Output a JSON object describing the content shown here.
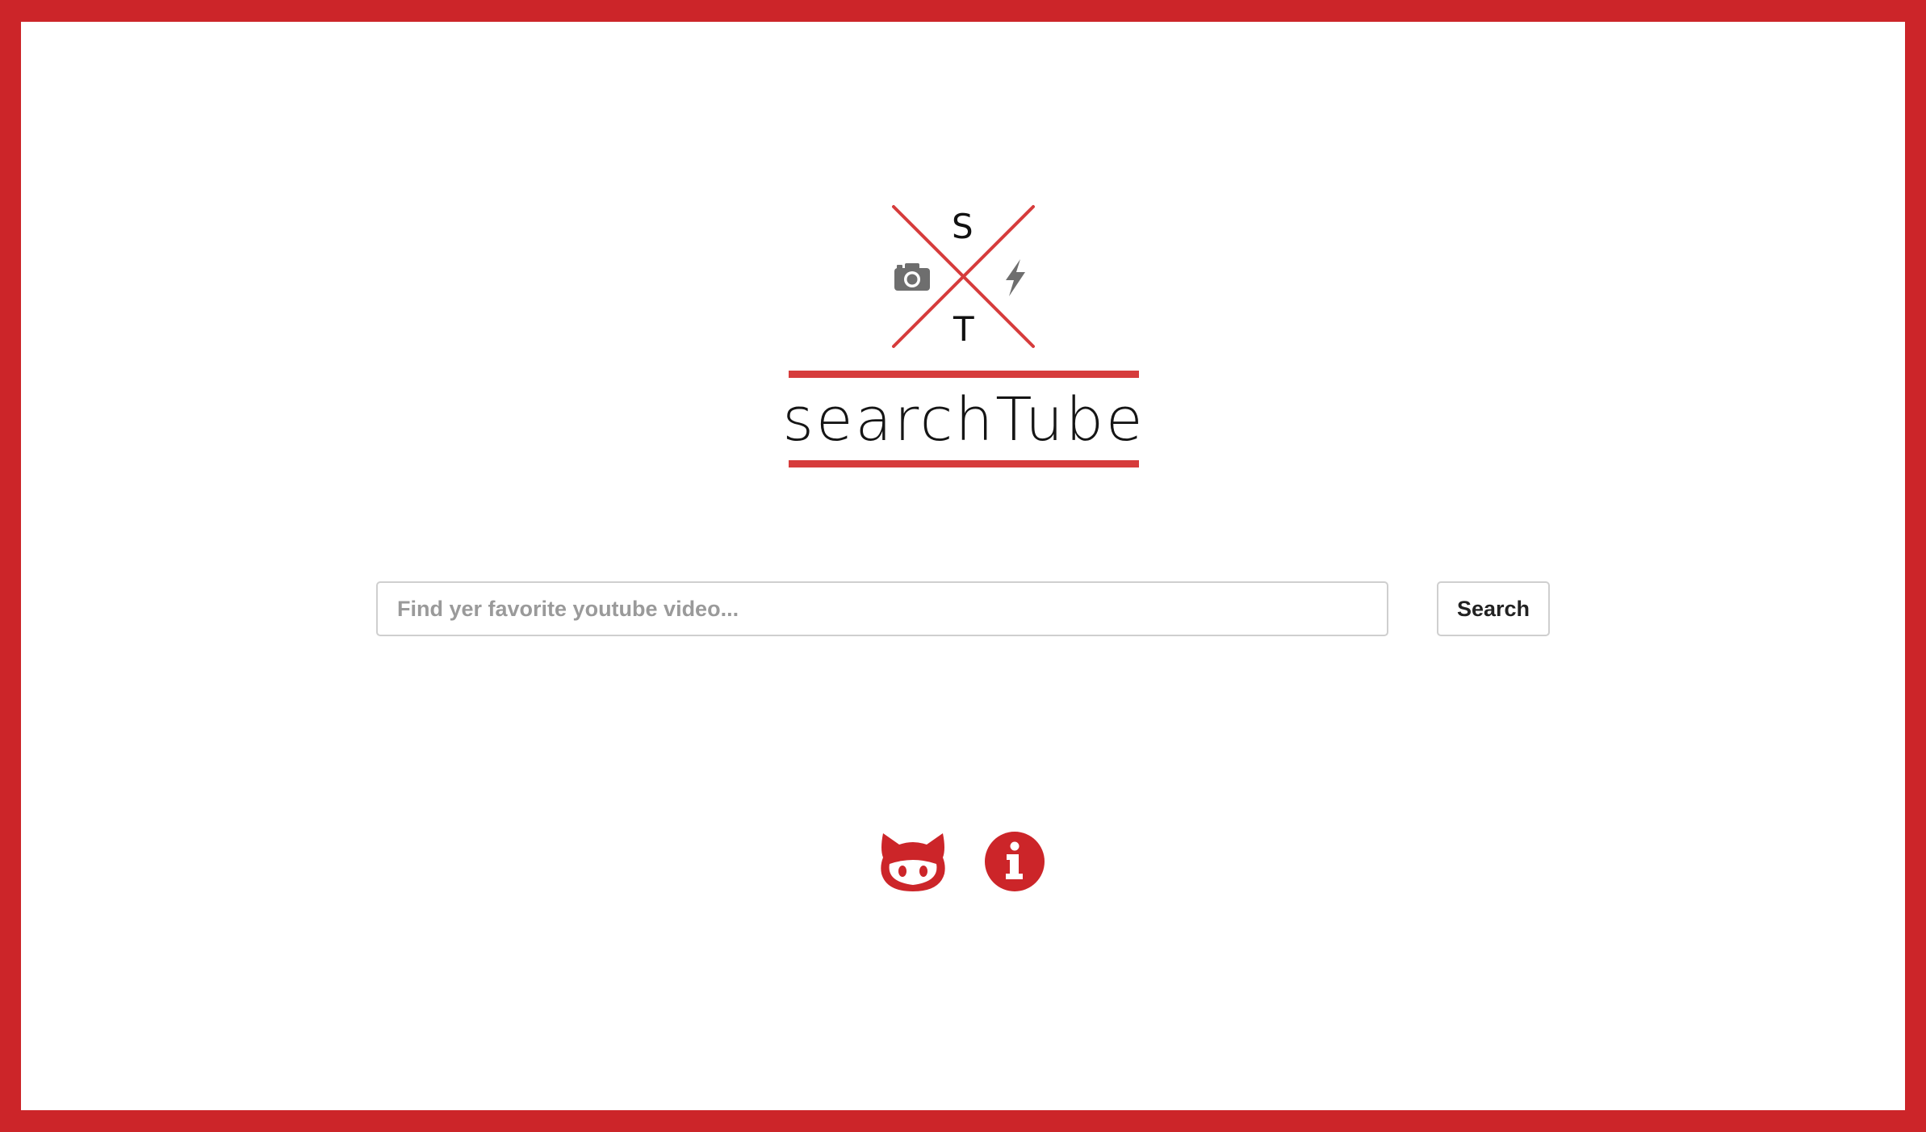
{
  "app": {
    "name": "searchTube",
    "brand_color": "#cc2529",
    "accent_color": "#d63c3c"
  },
  "logo": {
    "letter_top": "S",
    "letter_bottom": "T",
    "left_icon": "camera-icon",
    "right_icon": "lightning-bolt-icon",
    "wordmark": "searchTube"
  },
  "search": {
    "placeholder": "Find yer favorite youtube video...",
    "value": "",
    "button_label": "Search"
  },
  "footer": {
    "links": [
      {
        "icon": "github-octocat-icon"
      },
      {
        "icon": "info-icon"
      }
    ]
  }
}
